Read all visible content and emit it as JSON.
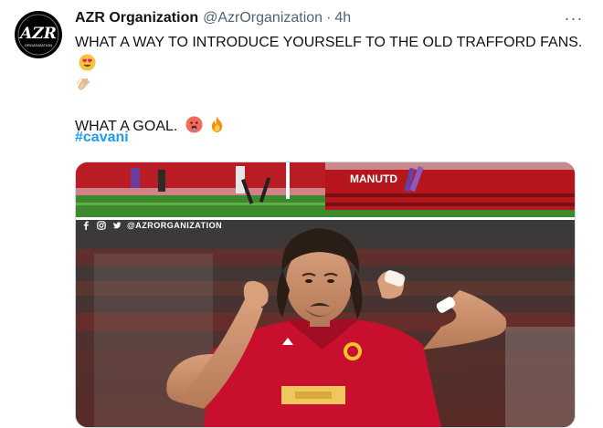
{
  "tweet": {
    "author_name": "AZR Organization",
    "handle": "@AzrOrganization",
    "separator": "·",
    "timestamp": "4h",
    "more_label": "···",
    "text_line_1": "WHAT A WAY TO INTRODUCE YOURSELF TO THE OLD TRAFFORD FANS.",
    "text_line_2": "WHAT A GOAL.",
    "hashtag": "#cavani"
  },
  "avatar": {
    "logo_text": "AZR",
    "logo_subtext": "ORGANIZATION"
  },
  "media": {
    "watermark": "@AZRORGANIZATION",
    "board_text": "MANUTD",
    "icons": [
      "facebook-icon",
      "instagram-icon",
      "twitter-icon"
    ]
  },
  "emojis": [
    "heart-eyes-emoji",
    "clapping-hands-emoji",
    "hot-face-emoji",
    "fire-emoji"
  ],
  "colors": {
    "link": "#1d9bf0",
    "secondary_text": "#536471",
    "jersey_red": "#c8102e"
  }
}
